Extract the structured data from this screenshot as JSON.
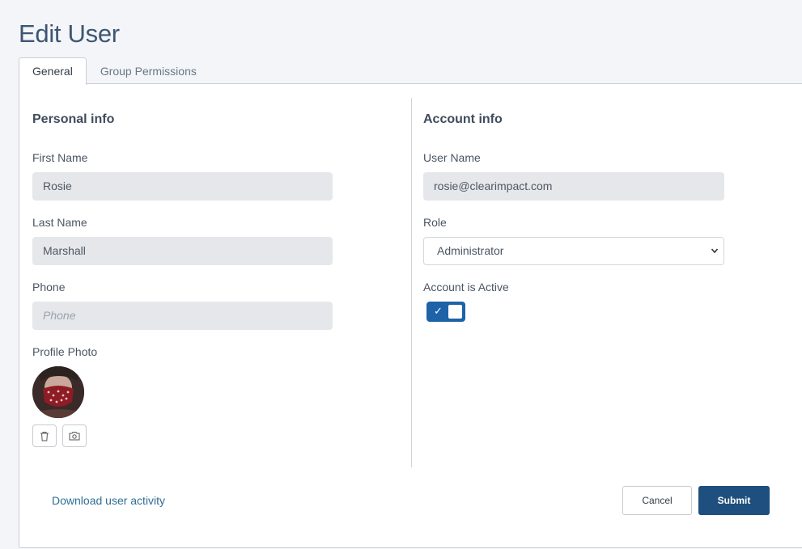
{
  "page": {
    "title": "Edit User"
  },
  "tabs": [
    {
      "label": "General",
      "active": true
    },
    {
      "label": "Group Permissions",
      "active": false
    }
  ],
  "personal": {
    "section_title": "Personal info",
    "first_name": {
      "label": "First Name",
      "value": "Rosie"
    },
    "last_name": {
      "label": "Last Name",
      "value": "Marshall"
    },
    "phone": {
      "label": "Phone",
      "value": "",
      "placeholder": "Phone"
    },
    "profile_photo": {
      "label": "Profile Photo"
    }
  },
  "account": {
    "section_title": "Account info",
    "user_name": {
      "label": "User Name",
      "value": "rosie@clearimpact.com"
    },
    "role": {
      "label": "Role",
      "value": "Administrator"
    },
    "active": {
      "label": "Account is Active",
      "checked": true
    }
  },
  "footer": {
    "download_link": "Download user activity",
    "cancel_label": "Cancel",
    "submit_label": "Submit"
  },
  "colors": {
    "primary": "#1e4f7e",
    "toggle_on": "#1e62a8",
    "link": "#2f6f96",
    "title": "#3f5672"
  },
  "icons": {
    "delete": "trash-icon",
    "camera": "camera-icon",
    "chevron": "chevron-down-icon",
    "check": "check-icon"
  }
}
